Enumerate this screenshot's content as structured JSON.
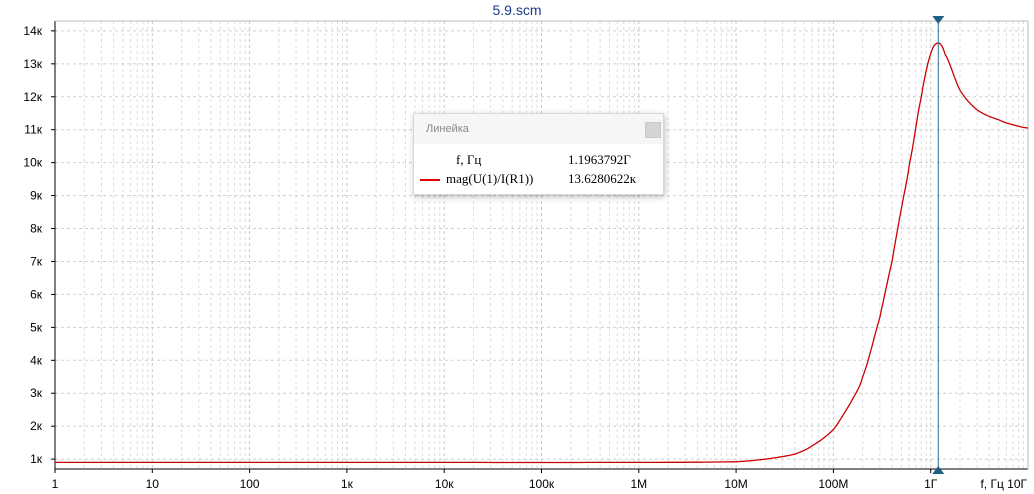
{
  "window_title": "5.9.scm",
  "chart_data": {
    "type": "line",
    "title": "5.9.scm",
    "xscale": "log",
    "xlim": [
      1,
      10000000000
    ],
    "ylim": [
      700,
      14300
    ],
    "x_ticks": [
      {
        "v": 1,
        "label": "1"
      },
      {
        "v": 10,
        "label": "10"
      },
      {
        "v": 100,
        "label": "100"
      },
      {
        "v": 1000,
        "label": "1к"
      },
      {
        "v": 10000,
        "label": "10к"
      },
      {
        "v": 100000,
        "label": "100к"
      },
      {
        "v": 1000000,
        "label": "1M"
      },
      {
        "v": 10000000,
        "label": "10M"
      },
      {
        "v": 100000000,
        "label": "100M"
      },
      {
        "v": 1000000000,
        "label": "1Г"
      }
    ],
    "x_axis_end_label": "f, Гц  10Г",
    "y_ticks": [
      {
        "v": 1000,
        "label": "1к"
      },
      {
        "v": 2000,
        "label": "2к"
      },
      {
        "v": 3000,
        "label": "3к"
      },
      {
        "v": 4000,
        "label": "4к"
      },
      {
        "v": 5000,
        "label": "5к"
      },
      {
        "v": 6000,
        "label": "6к"
      },
      {
        "v": 7000,
        "label": "7к"
      },
      {
        "v": 8000,
        "label": "8к"
      },
      {
        "v": 9000,
        "label": "9к"
      },
      {
        "v": 10000,
        "label": "10к"
      },
      {
        "v": 11000,
        "label": "11к"
      },
      {
        "v": 12000,
        "label": "12к"
      },
      {
        "v": 13000,
        "label": "13к"
      },
      {
        "v": 14000,
        "label": "14к"
      }
    ],
    "grid": true,
    "series": [
      {
        "name": "mag(U(1)/I(R1))",
        "color": "#cc0000",
        "x": [
          1,
          1000,
          1000000,
          10000000,
          20000000,
          40000000,
          60000000,
          100000000,
          150000000,
          200000000,
          300000000,
          400000000,
          500000000,
          600000000,
          800000000,
          1000000000,
          1196379200,
          1400000000,
          2000000000,
          3000000000,
          5000000000,
          7000000000,
          10000000000
        ],
        "y": [
          900,
          900,
          900,
          920,
          1000,
          1150,
          1400,
          1900,
          2700,
          3500,
          5300,
          7000,
          8600,
          9900,
          12000,
          13300,
          13628,
          13300,
          12200,
          11600,
          11300,
          11150,
          11050
        ]
      }
    ],
    "cursor": {
      "x": 1196379200,
      "y": 13628.0622
    }
  },
  "ruler": {
    "title": "Линейка",
    "rows": [
      {
        "label": "f, Гц",
        "value": "1.1963792Г"
      },
      {
        "label": "mag(U(1)/I(R1))",
        "value": "13.6280622к"
      }
    ]
  }
}
